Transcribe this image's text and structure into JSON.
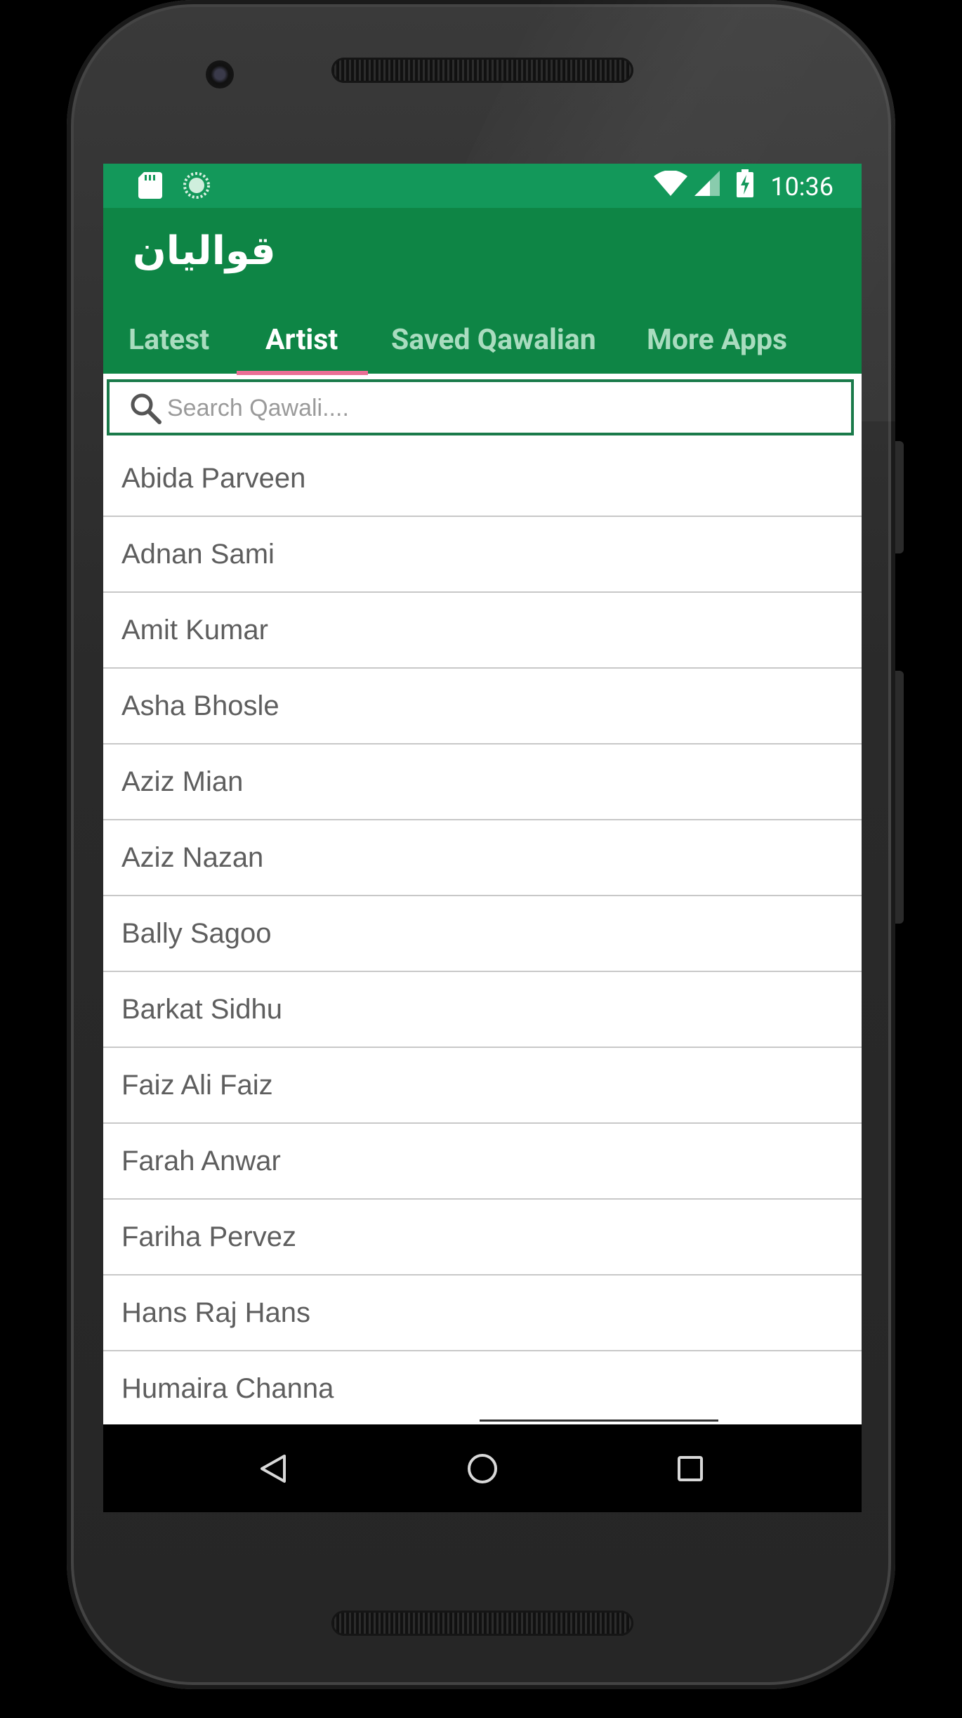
{
  "status_bar": {
    "time": "10:36",
    "icons": [
      "sd-card-icon",
      "sync-icon",
      "wifi-icon",
      "cell-signal-icon",
      "battery-charging-icon"
    ]
  },
  "app_bar": {
    "title": "قواليان"
  },
  "tabs": [
    {
      "label": "Latest",
      "active": false
    },
    {
      "label": "Artist",
      "active": true
    },
    {
      "label": "Saved Qawalian",
      "active": false
    },
    {
      "label": "More Apps",
      "active": false
    }
  ],
  "search": {
    "placeholder": "Search Qawali....",
    "value": ""
  },
  "artists": [
    "Abida Parveen",
    "Adnan Sami",
    "Amit Kumar",
    "Asha Bhosle",
    "Aziz Mian",
    "Aziz Nazan",
    "Bally Sagoo",
    "Barkat Sidhu",
    "Faiz Ali Faiz",
    "Farah Anwar",
    "Fariha Pervez",
    "Hans Raj Hans",
    "Humaira Channa"
  ],
  "nav_bar": {
    "buttons": [
      "back-icon",
      "home-icon",
      "recents-icon"
    ]
  },
  "colors": {
    "status_bar": "#13985a",
    "app_bar": "#0e8545",
    "tab_indicator": "#ea6e95",
    "search_border": "#1a7a4a"
  }
}
